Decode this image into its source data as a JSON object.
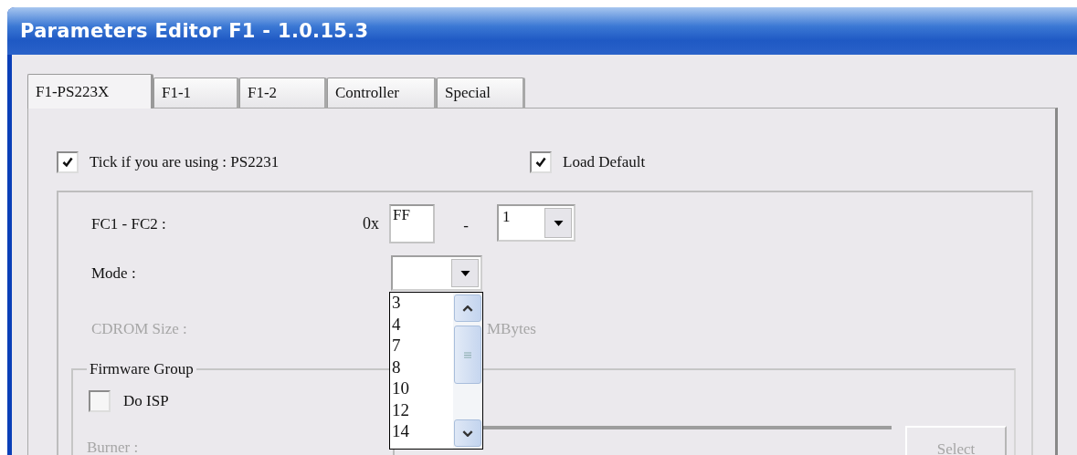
{
  "window": {
    "title": "Parameters Editor F1 - 1.0.15.3"
  },
  "tabs": [
    {
      "label": "F1-PS223X",
      "selected": true
    },
    {
      "label": "F1-1",
      "selected": false
    },
    {
      "label": "F1-2",
      "selected": false
    },
    {
      "label": "Controller",
      "selected": false
    },
    {
      "label": "Special",
      "selected": false
    }
  ],
  "options": [
    {
      "label": "Tick if you are using : PS2231",
      "checked": true
    },
    {
      "label": "Load Default",
      "checked": true
    }
  ],
  "fc": {
    "label": "FC1 - FC2 :",
    "prefix": "0x",
    "value": "FF",
    "separator": "-",
    "select_value": "1"
  },
  "mode": {
    "label": "Mode :",
    "expanded": true,
    "items": [
      "3",
      "4",
      "7",
      "8",
      "10",
      "12",
      "14"
    ]
  },
  "cdrom": {
    "label": "CDROM Size :",
    "unit": "MBytes",
    "disabled": true
  },
  "firmware_group": {
    "title": "Firmware Group",
    "do_isp": {
      "label": "Do ISP",
      "checked": false
    },
    "burner": {
      "label": "Burner :",
      "disabled": true
    },
    "select_button": {
      "label": "Select",
      "disabled": true
    }
  }
}
